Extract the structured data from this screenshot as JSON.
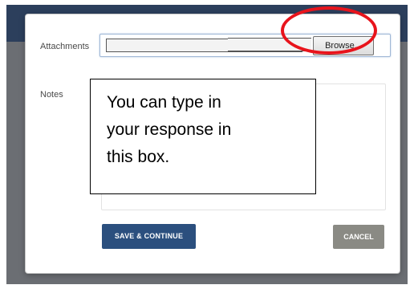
{
  "dialog": {
    "attachments_label": "Attachments",
    "browse_label": "Browse...",
    "notes_label": "Notes",
    "callout_lines": [
      "You can type in",
      "your response in",
      "this box."
    ],
    "save_label": "SAVE & CONTINUE",
    "cancel_label": "CANCEL"
  },
  "colors": {
    "header_band": "#2c3f5c",
    "overlay": "#6b6e73",
    "save_button": "#2b4f7e",
    "cancel_button": "#8a8a84",
    "highlight_circle": "#e8141c"
  }
}
